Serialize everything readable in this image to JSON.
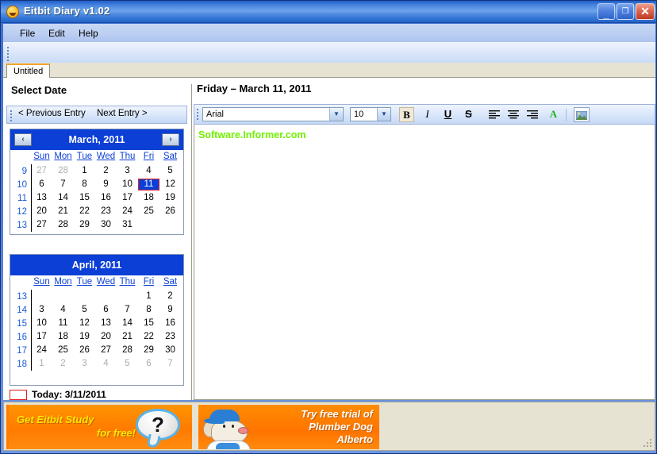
{
  "window": {
    "title": "Eitbit Diary v1.02",
    "icon": "smiley-icon",
    "minimize_label": "_",
    "maximize_label": "❐",
    "close_label": "✕"
  },
  "menubar": {
    "items": [
      {
        "label": "File"
      },
      {
        "label": "Edit"
      },
      {
        "label": "Help"
      }
    ]
  },
  "tabs": [
    {
      "label": "Untitled"
    }
  ],
  "left_pane": {
    "heading": "Select Date",
    "nav": {
      "previous_label": "< Previous Entry",
      "next_label": "Next Entry >"
    },
    "today": {
      "label": "Today: 3/11/2011"
    },
    "calendars": [
      {
        "id": "march",
        "title": "March, 2011",
        "prev_arrow": "‹",
        "next_arrow": "›",
        "day_headers": [
          "Sun",
          "Mon",
          "Tue",
          "Wed",
          "Thu",
          "Fri",
          "Sat"
        ],
        "week_numbers": [
          "9",
          "10",
          "11",
          "12",
          "13"
        ],
        "rows": [
          [
            {
              "d": "27",
              "state": "out"
            },
            {
              "d": "28",
              "state": "out"
            },
            {
              "d": "1",
              "state": "in"
            },
            {
              "d": "2",
              "state": "in"
            },
            {
              "d": "3",
              "state": "in"
            },
            {
              "d": "4",
              "state": "in"
            },
            {
              "d": "5",
              "state": "in"
            }
          ],
          [
            {
              "d": "6",
              "state": "in"
            },
            {
              "d": "7",
              "state": "in"
            },
            {
              "d": "8",
              "state": "in"
            },
            {
              "d": "9",
              "state": "in"
            },
            {
              "d": "10",
              "state": "in"
            },
            {
              "d": "11",
              "state": "sel"
            },
            {
              "d": "12",
              "state": "in"
            }
          ],
          [
            {
              "d": "13",
              "state": "in"
            },
            {
              "d": "14",
              "state": "in"
            },
            {
              "d": "15",
              "state": "in"
            },
            {
              "d": "16",
              "state": "in"
            },
            {
              "d": "17",
              "state": "in"
            },
            {
              "d": "18",
              "state": "in"
            },
            {
              "d": "19",
              "state": "in"
            }
          ],
          [
            {
              "d": "20",
              "state": "in"
            },
            {
              "d": "21",
              "state": "in"
            },
            {
              "d": "22",
              "state": "in"
            },
            {
              "d": "23",
              "state": "in"
            },
            {
              "d": "24",
              "state": "in"
            },
            {
              "d": "25",
              "state": "in"
            },
            {
              "d": "26",
              "state": "in"
            }
          ],
          [
            {
              "d": "27",
              "state": "in"
            },
            {
              "d": "28",
              "state": "in"
            },
            {
              "d": "29",
              "state": "in"
            },
            {
              "d": "30",
              "state": "in"
            },
            {
              "d": "31",
              "state": "in"
            },
            {
              "d": "",
              "state": "empty"
            },
            {
              "d": "",
              "state": "empty"
            }
          ]
        ]
      },
      {
        "id": "april",
        "title": "April, 2011",
        "prev_arrow": "",
        "next_arrow": "",
        "day_headers": [
          "Sun",
          "Mon",
          "Tue",
          "Wed",
          "Thu",
          "Fri",
          "Sat"
        ],
        "week_numbers": [
          "13",
          "14",
          "15",
          "16",
          "17",
          "18"
        ],
        "rows": [
          [
            {
              "d": "",
              "state": "empty"
            },
            {
              "d": "",
              "state": "empty"
            },
            {
              "d": "",
              "state": "empty"
            },
            {
              "d": "",
              "state": "empty"
            },
            {
              "d": "",
              "state": "empty"
            },
            {
              "d": "1",
              "state": "in"
            },
            {
              "d": "2",
              "state": "in"
            }
          ],
          [
            {
              "d": "3",
              "state": "in"
            },
            {
              "d": "4",
              "state": "in"
            },
            {
              "d": "5",
              "state": "in"
            },
            {
              "d": "6",
              "state": "in"
            },
            {
              "d": "7",
              "state": "in"
            },
            {
              "d": "8",
              "state": "in"
            },
            {
              "d": "9",
              "state": "in"
            }
          ],
          [
            {
              "d": "10",
              "state": "in"
            },
            {
              "d": "11",
              "state": "in"
            },
            {
              "d": "12",
              "state": "in"
            },
            {
              "d": "13",
              "state": "in"
            },
            {
              "d": "14",
              "state": "in"
            },
            {
              "d": "15",
              "state": "in"
            },
            {
              "d": "16",
              "state": "in"
            }
          ],
          [
            {
              "d": "17",
              "state": "in"
            },
            {
              "d": "18",
              "state": "in"
            },
            {
              "d": "19",
              "state": "in"
            },
            {
              "d": "20",
              "state": "in"
            },
            {
              "d": "21",
              "state": "in"
            },
            {
              "d": "22",
              "state": "in"
            },
            {
              "d": "23",
              "state": "in"
            }
          ],
          [
            {
              "d": "24",
              "state": "in"
            },
            {
              "d": "25",
              "state": "in"
            },
            {
              "d": "26",
              "state": "in"
            },
            {
              "d": "27",
              "state": "in"
            },
            {
              "d": "28",
              "state": "in"
            },
            {
              "d": "29",
              "state": "in"
            },
            {
              "d": "30",
              "state": "in"
            }
          ],
          [
            {
              "d": "1",
              "state": "out"
            },
            {
              "d": "2",
              "state": "out"
            },
            {
              "d": "3",
              "state": "out"
            },
            {
              "d": "4",
              "state": "out"
            },
            {
              "d": "5",
              "state": "out"
            },
            {
              "d": "6",
              "state": "out"
            },
            {
              "d": "7",
              "state": "out"
            }
          ]
        ]
      }
    ]
  },
  "right_pane": {
    "day_title": "Friday – March 11, 2011",
    "format_toolbar": {
      "font": {
        "value": "Arial",
        "arrow": "▼"
      },
      "size": {
        "value": "10",
        "arrow": "▼"
      },
      "bold_label": "B",
      "italic_label": "I",
      "underline_label": "U",
      "strike_label": "S",
      "align_left": "align-left-icon",
      "align_center": "align-center-icon",
      "align_right": "align-right-icon",
      "font_color_label": "A",
      "font_color": "#22b422",
      "insert_picture": "picture-icon"
    },
    "editor": {
      "content_line_1": "Software.Informer.com",
      "content_color": "#7cf117"
    }
  },
  "bottom_bar": {
    "ads": [
      {
        "id": "eitbit-study",
        "line1": "Get Eitbit Study",
        "line2": "for free!",
        "badge": "?",
        "bg": "#ff7b00",
        "text_color": "#ffe800"
      },
      {
        "id": "plumber-dog",
        "line1": "Try free trial of",
        "line2": "Plumber Dog",
        "line3": "Alberto",
        "bg": "#ff7400",
        "text_color": "#ffffff"
      }
    ]
  }
}
